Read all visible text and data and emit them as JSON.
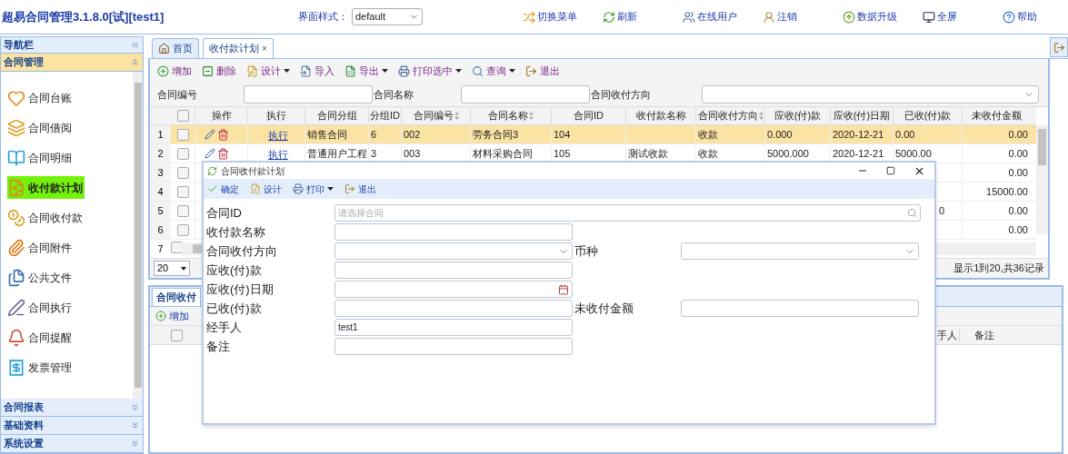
{
  "app_title": "超易合同管理3.1.8.0[试][test1]",
  "theme_picker": {
    "label": "界面样式：",
    "value": "default"
  },
  "top_menu": [
    {
      "label": "切换菜单"
    },
    {
      "label": "刷新"
    },
    {
      "label": "在线用户"
    },
    {
      "label": "注销"
    },
    {
      "label": "数据升级"
    },
    {
      "label": "全屏"
    },
    {
      "label": "帮助"
    }
  ],
  "sidebar": {
    "title": "导航栏",
    "sections": [
      {
        "label": "合同管理",
        "expanded": true,
        "items": [
          {
            "label": "合同台账",
            "selected": false
          },
          {
            "label": "合同借阅",
            "selected": false
          },
          {
            "label": "合同明细",
            "selected": false
          },
          {
            "label": "收付款计划",
            "selected": true
          },
          {
            "label": "合同收付款",
            "selected": false
          },
          {
            "label": "合同附件",
            "selected": false
          },
          {
            "label": "公共文件",
            "selected": false
          },
          {
            "label": "合同执行",
            "selected": false
          },
          {
            "label": "合同提醒",
            "selected": false
          },
          {
            "label": "发票管理",
            "selected": false
          }
        ]
      },
      {
        "label": "合同报表",
        "expanded": false
      },
      {
        "label": "基础资料",
        "expanded": false
      },
      {
        "label": "系统设置",
        "expanded": false
      }
    ]
  },
  "tabs": [
    {
      "label": "首页",
      "selected": false
    },
    {
      "label": "收付款计划",
      "selected": true,
      "close": "×"
    }
  ],
  "toolbar": [
    {
      "label": "增加",
      "dropdown": false
    },
    {
      "label": "删除",
      "dropdown": false
    },
    {
      "label": "设计",
      "dropdown": true
    },
    {
      "label": "导入",
      "dropdown": false
    },
    {
      "label": "导出",
      "dropdown": true
    },
    {
      "label": "打印选中",
      "dropdown": true
    },
    {
      "label": "查询",
      "dropdown": true
    },
    {
      "label": "退出",
      "dropdown": false
    }
  ],
  "filters": [
    {
      "label": "合同编号",
      "kind": "text"
    },
    {
      "label": "合同名称",
      "kind": "text"
    },
    {
      "label": "合同收付方向",
      "kind": "select"
    }
  ],
  "grid": {
    "all_checked": false,
    "columns": [
      {
        "label": "操作",
        "sortable": false
      },
      {
        "label": "执行",
        "sortable": false
      },
      {
        "label": "合同分组",
        "sortable": false
      },
      {
        "label": "分组ID",
        "sortable": false
      },
      {
        "label": "合同编号",
        "sortable": true
      },
      {
        "label": "合同名称",
        "sortable": true
      },
      {
        "label": "合同ID",
        "sortable": false
      },
      {
        "label": "收付款名称",
        "sortable": false
      },
      {
        "label": "合同收付方向",
        "sortable": true
      },
      {
        "label": "应收(付)款",
        "sortable": false
      },
      {
        "label": "应收(付)日期",
        "sortable": false
      },
      {
        "label": "已收(付)款",
        "sortable": false
      },
      {
        "label": "未收付金额",
        "sortable": false
      }
    ],
    "rows": [
      {
        "num": "1",
        "selected": true,
        "checked": false,
        "actions": true,
        "exec": "执行",
        "group": "销售合同",
        "group_id": "6",
        "code": "002",
        "name": "劳务合同3",
        "contract_id": "104",
        "direction": "收款",
        "due_amount": "0.000",
        "due_date": "2020-12-21",
        "received": "0.00",
        "balance": "0.00"
      },
      {
        "num": "2",
        "selected": false,
        "checked": false,
        "actions": true,
        "exec": "执行",
        "group": "普通用户工程",
        "group_id": "3",
        "code": "003",
        "name": "材料采购合同",
        "contract_id": "105",
        "pay_name": "测试收款",
        "direction": "收款",
        "due_amount": "5000.000",
        "due_date": "2020-12-21",
        "received": "5000.00",
        "balance": "0.00"
      },
      {
        "num": "3",
        "selected": false,
        "checked": false,
        "balance": "0.00"
      },
      {
        "num": "4",
        "selected": false,
        "checked": false,
        "balance": "15000.00"
      },
      {
        "num": "5",
        "selected": false,
        "checked": false,
        "received": "0",
        "balance": "0.00"
      },
      {
        "num": "6",
        "selected": false,
        "checked": false,
        "balance": "0.00"
      },
      {
        "num": "7",
        "selected": false,
        "checked": false
      }
    ]
  },
  "pager": {
    "page_size": "20",
    "summary": "显示1到20,共36记录"
  },
  "lower_panel": {
    "tab": "合同收付",
    "all_checked": false,
    "toolbar": [
      {
        "label": "增加"
      }
    ],
    "columns": [
      {
        "label": "手人"
      },
      {
        "label": "备注"
      }
    ]
  },
  "dialog": {
    "title": "合同收付款计划",
    "toolbar": [
      {
        "label": "确定",
        "dropdown": false
      },
      {
        "label": "设计",
        "dropdown": false
      },
      {
        "label": "打印",
        "dropdown": true
      },
      {
        "label": "退出",
        "dropdown": false
      }
    ],
    "rows": [
      [
        {
          "label": "合同ID",
          "kind": "search",
          "placeholder": "请选择合同"
        }
      ],
      [
        {
          "label": "收付款名称",
          "kind": "text"
        }
      ],
      [
        {
          "label": "合同收付方向",
          "kind": "select"
        },
        {
          "label": "币种",
          "kind": "select"
        }
      ],
      [
        {
          "label": "应收(付)款",
          "kind": "text"
        }
      ],
      [
        {
          "label": "应收(付)日期",
          "kind": "date"
        }
      ],
      [
        {
          "label": "已收(付)款",
          "kind": "text"
        },
        {
          "label": "未收付金额",
          "kind": "text"
        }
      ],
      [
        {
          "label": "经手人",
          "kind": "text",
          "value": "test1"
        }
      ],
      [
        {
          "label": "备注",
          "kind": "text"
        }
      ]
    ]
  }
}
